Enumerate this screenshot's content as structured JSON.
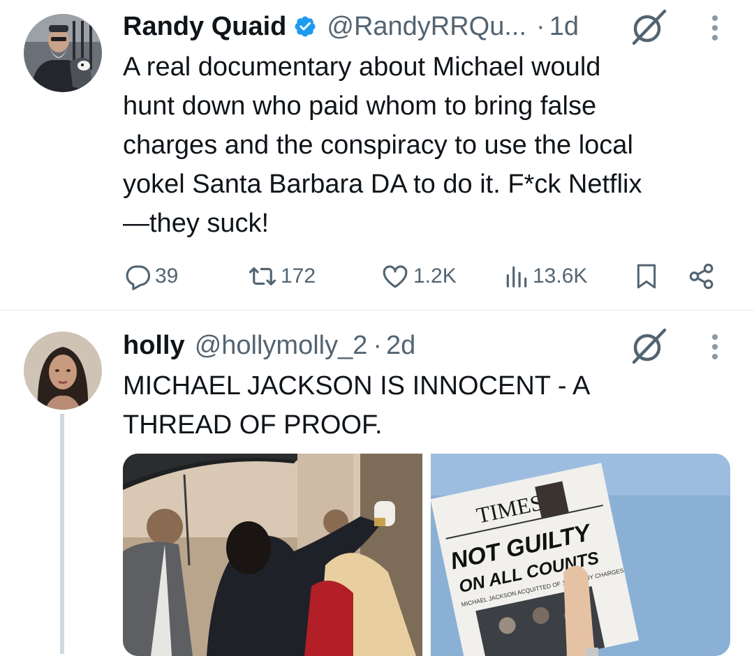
{
  "tweets": [
    {
      "author": {
        "name": "Randy Quaid",
        "handle": "@RandyRRQu...",
        "verified": true
      },
      "time": "1d",
      "separator": "·",
      "text": "A real documentary about Michael would\nhunt down who paid whom to bring false\ncharges and the conspiracy to use the local\nyokel Santa Barbara DA to do it. F*ck Netflix\n—they suck!",
      "stats": {
        "replies": "39",
        "reposts": "172",
        "likes": "1.2K",
        "views": "13.6K"
      }
    },
    {
      "author": {
        "name": "holly",
        "handle": "@hollymolly_2"
      },
      "time": "2d",
      "separator": "·",
      "text": "MICHAEL JACKSON IS INNOCENT - A\nTHREAD OF PROOF.",
      "media": {
        "newspaper": {
          "masthead": "TIMES",
          "headline_1": "NOT GUILTY",
          "headline_2": "ON ALL COUNTS",
          "subline": "MICHAEL JACKSON ACQUITTED OF 10 FELONY CHARGES"
        }
      }
    }
  ],
  "colors": {
    "text": "#0f1419",
    "secondary": "#536471",
    "verified": "#1d9bf0",
    "divider": "#e6e9ec",
    "thread_line": "#cfd9de"
  },
  "icons": [
    "verified-badge-icon",
    "grok-icon",
    "more-icon",
    "reply-icon",
    "repost-icon",
    "like-icon",
    "views-icon",
    "bookmark-icon",
    "share-icon"
  ]
}
